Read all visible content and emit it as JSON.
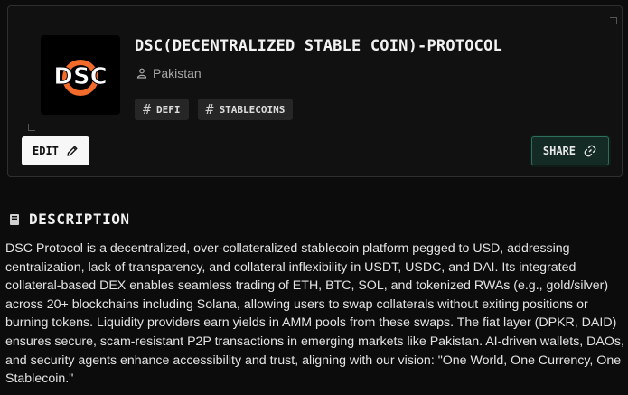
{
  "project": {
    "logo_text": "DSC",
    "title": "DSC(DECENTRALIZED STABLE COIN)-PROTOCOL",
    "location": "Pakistan",
    "tags": [
      {
        "hash": "#",
        "label": "DEFI"
      },
      {
        "hash": "#",
        "label": "STABLECOINS"
      }
    ]
  },
  "actions": {
    "edit_label": "EDIT",
    "share_label": "SHARE"
  },
  "description": {
    "heading": "DESCRIPTION",
    "body": "DSC Protocol is a decentralized, over-collateralized stablecoin platform pegged to USD, addressing centralization, lack of transparency, and collateral inflexibility in USDT, USDC, and DAI. Its integrated collateral-based DEX enables seamless trading of ETH, BTC, SOL, and tokenized RWAs (e.g., gold/silver) across 20+ blockchains including Solana, allowing users to swap collaterals without exiting positions or burning tokens. Liquidity providers earn yields in AMM pools from these swaps. The fiat layer (DPKR, DAID) ensures secure, scam-resistant P2P transactions in emerging markets like Pakistan. AI-driven wallets, DAOs, and security agents enhance accessibility and trust, aligning with our vision: \"One World, One Currency, One Stablecoin.\""
  },
  "colors": {
    "logo_accent": "#f26b2a",
    "share_border": "#2f6e5c",
    "share_bg": "#142a24"
  },
  "icons": [
    "user-icon",
    "hash-icon",
    "pencil-icon",
    "link-icon",
    "book-icon"
  ]
}
